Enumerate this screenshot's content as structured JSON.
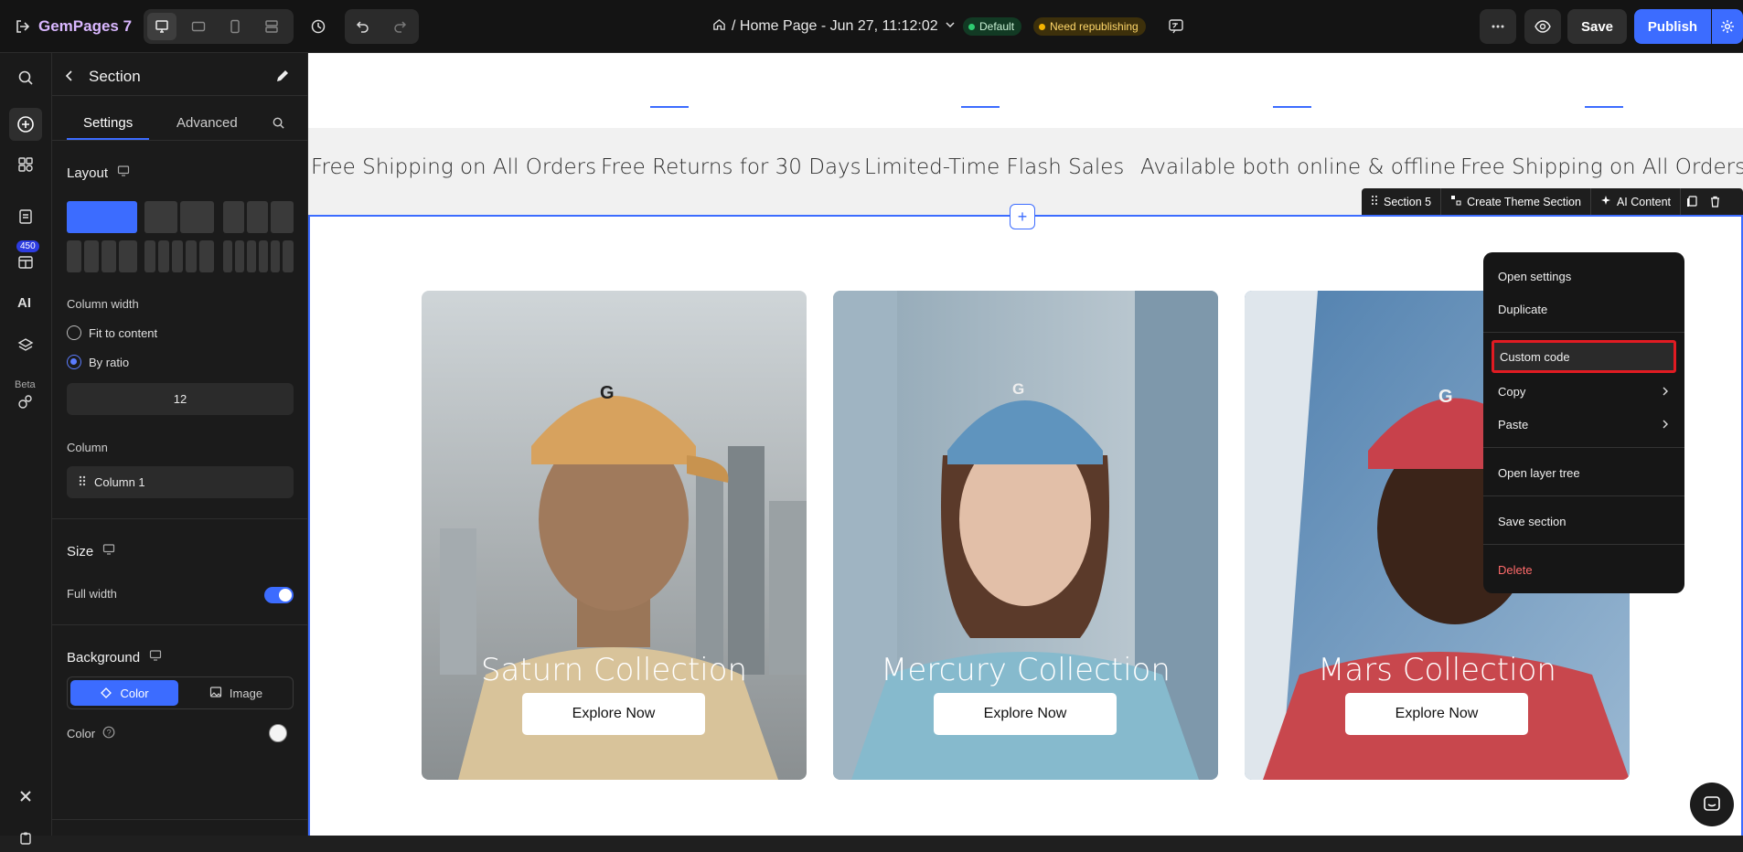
{
  "topbar": {
    "logo": "GemPages 7",
    "page_title": "/ Home Page - Jun 27, 11:12:02",
    "status_default": "Default",
    "status_republish": "Need republishing",
    "save_label": "Save",
    "publish_label": "Publish",
    "colors": {
      "default_pill": "#1f9d55",
      "republish_pill": "#e5a100",
      "publish": "#3c6cff"
    }
  },
  "sidebar": {
    "badge": "450",
    "beta": "Beta"
  },
  "panel": {
    "title": "Section",
    "tabs": [
      "Settings",
      "Advanced"
    ],
    "layout_heading": "Layout",
    "column_width_label": "Column width",
    "radio_fit": "Fit to content",
    "radio_ratio": "By ratio",
    "ratio_value": "12",
    "column_label": "Column",
    "column_item": "Column 1",
    "size_heading": "Size",
    "full_width_label": "Full width",
    "background_heading": "Background",
    "bg_color_tab": "Color",
    "bg_image_tab": "Image",
    "color_label": "Color"
  },
  "canvas": {
    "marquee": [
      "Free Shipping on All Orders",
      "Free Returns for 30 Days",
      "Limited-Time Flash Sales",
      "Available both online & offline",
      "Free Shipping on All Orders"
    ],
    "section_bar": {
      "section": "Section 5",
      "create": "Create Theme Section",
      "ai": "AI Content"
    },
    "cards": [
      {
        "title": "Saturn Collection",
        "button": "Explore Now",
        "cap_color": "#d7a25e",
        "shirt_color": "#d8c39a",
        "bg": "#c9cfd3"
      },
      {
        "title": "Mercury Collection",
        "button": "Explore Now",
        "cap_color": "#5f94be",
        "shirt_color": "#86bacd",
        "bg": "#a7b8c3"
      },
      {
        "title": "Mars Collection",
        "button": "Explore Now",
        "cap_color": "#c8414b",
        "shirt_color": "#c8474d",
        "bg": "#6c93b7"
      }
    ]
  },
  "context_menu": {
    "items": [
      "Open settings",
      "Duplicate",
      "Custom code",
      "Copy",
      "Paste",
      "Open layer tree",
      "Save section",
      "Delete"
    ],
    "highlighted": "Custom code",
    "delete_color": "#ff6b6b"
  }
}
